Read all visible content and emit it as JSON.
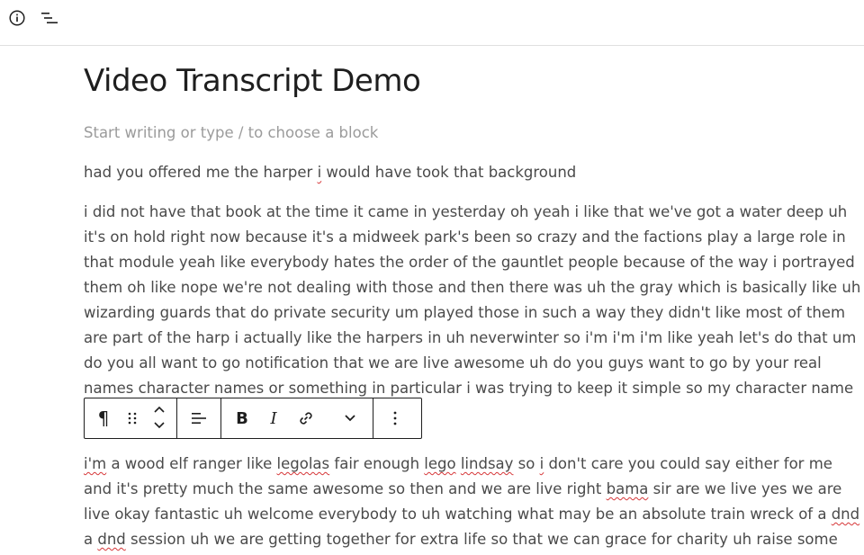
{
  "header": {
    "info_icon": "info-icon",
    "outline_icon": "list-view-icon"
  },
  "document": {
    "title": "Video Transcript Demo",
    "placeholder": "Start writing or type / to choose a block",
    "paragraph1": {
      "a": "had you offered me the harper ",
      "b": "i",
      "c": " would have took that background"
    },
    "paragraph2_lines": [
      "i did not have that book at the time it came in yesterday oh yeah i like that we've got a water deep uh",
      "it's on hold right now because it's a midweek park's been so crazy and the factions play a large role in",
      "that module yeah like everybody hates the order of the gauntlet people because of the way i portrayed",
      "them oh like nope we're not dealing with those and then there was uh the gray which is basically like uh",
      "wizarding guards that do private security um played those in such a way they didn't like most of them",
      "are part of the harp i actually like the harpers in uh neverwinter so i'm i'm i'm like yeah let's do that um",
      "do you all want to go notification that we are live awesome uh do you guys want to go by your real",
      "names character names or something in particular i was trying to keep it simple so my character name"
    ],
    "paragraph3": {
      "l1": {
        "s1": "i'm",
        "t1": " a wood elf ranger like ",
        "s2": "legolas",
        "t2": " fair enough ",
        "s3": "lego",
        "t3": " ",
        "s4": "lindsay",
        "t4": " so ",
        "s5": "i",
        "t5": " don't care you could say either for me"
      },
      "l2": {
        "t1": "and it's pretty much the same awesome so then and we are live right ",
        "s1": "bama",
        "t2": " sir are we live yes we are"
      },
      "l3": {
        "t1": "live okay fantastic uh welcome everybody to uh watching what may be an absolute train wreck of a ",
        "s1": "dnd"
      },
      "l4": {
        "t1": "a ",
        "s1": "dnd",
        "t2": " session uh we are getting together for extra life so that we can grace for charity uh raise some"
      }
    }
  },
  "toolbar": {
    "paragraph_symbol": "¶",
    "bold": "B",
    "italic": "I",
    "icons": [
      "paragraph-icon",
      "drag-handle-icon",
      "move-up-icon",
      "move-down-icon",
      "align-left-icon",
      "bold-icon",
      "italic-icon",
      "link-icon",
      "chevron-down-icon",
      "more-options-icon"
    ]
  },
  "colors": {
    "text": "#4a4a4a",
    "title": "#1e1e1e",
    "placeholder": "#9b9b9b",
    "spellcheck": "#d63638",
    "border": "#1e1e1e"
  }
}
